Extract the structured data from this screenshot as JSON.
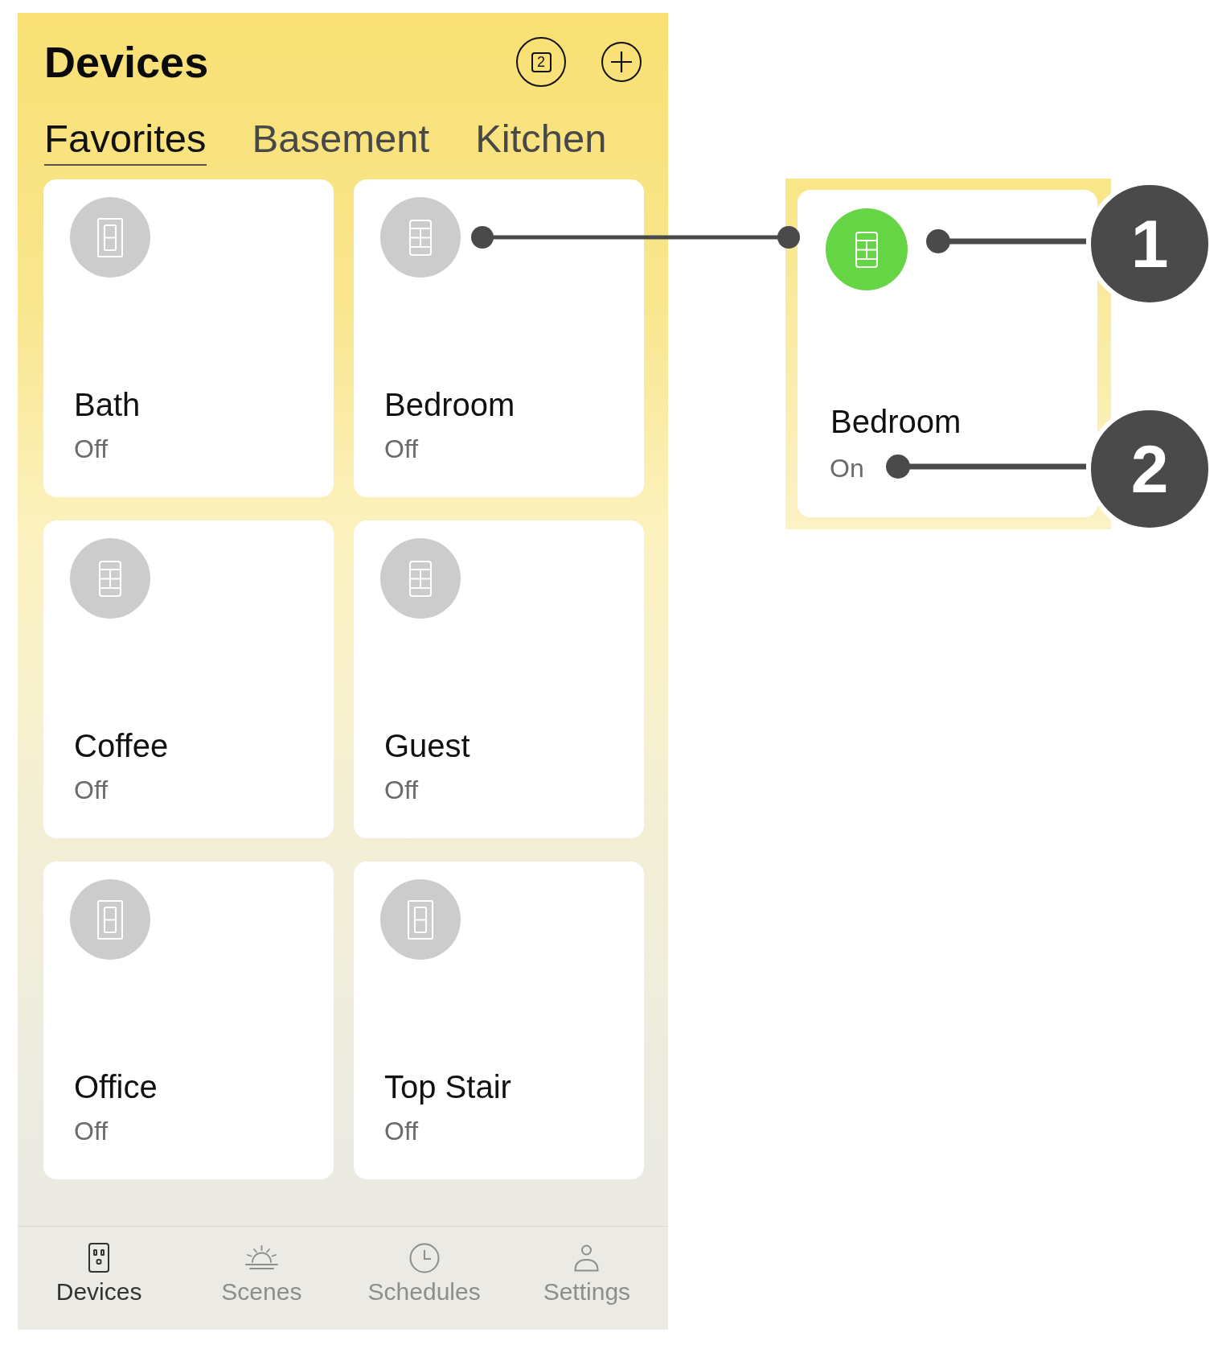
{
  "header": {
    "title": "Devices",
    "count_button": {
      "label": "2"
    }
  },
  "tabs": [
    {
      "label": "Favorites",
      "selected": true
    },
    {
      "label": "Basement",
      "selected": false
    },
    {
      "label": "Kitchen",
      "selected": false
    }
  ],
  "devices": [
    {
      "name": "Bath",
      "status": "Off",
      "on": false,
      "kind": "switch"
    },
    {
      "name": "Bedroom",
      "status": "Off",
      "on": false,
      "kind": "keypad"
    },
    {
      "name": "Coffee",
      "status": "Off",
      "on": false,
      "kind": "keypad"
    },
    {
      "name": "Guest",
      "status": "Off",
      "on": false,
      "kind": "keypad"
    },
    {
      "name": "Office",
      "status": "Off",
      "on": false,
      "kind": "switch"
    },
    {
      "name": "Top Stair",
      "status": "Off",
      "on": false,
      "kind": "switch"
    }
  ],
  "bottom_nav": [
    {
      "label": "Devices",
      "selected": true
    },
    {
      "label": "Scenes",
      "selected": false
    },
    {
      "label": "Schedules",
      "selected": false
    },
    {
      "label": "Settings",
      "selected": false
    }
  ],
  "callout": {
    "device": {
      "name": "Bedroom",
      "status": "On",
      "on": true,
      "kind": "keypad"
    },
    "markers": [
      {
        "number": "1"
      },
      {
        "number": "2"
      }
    ]
  }
}
